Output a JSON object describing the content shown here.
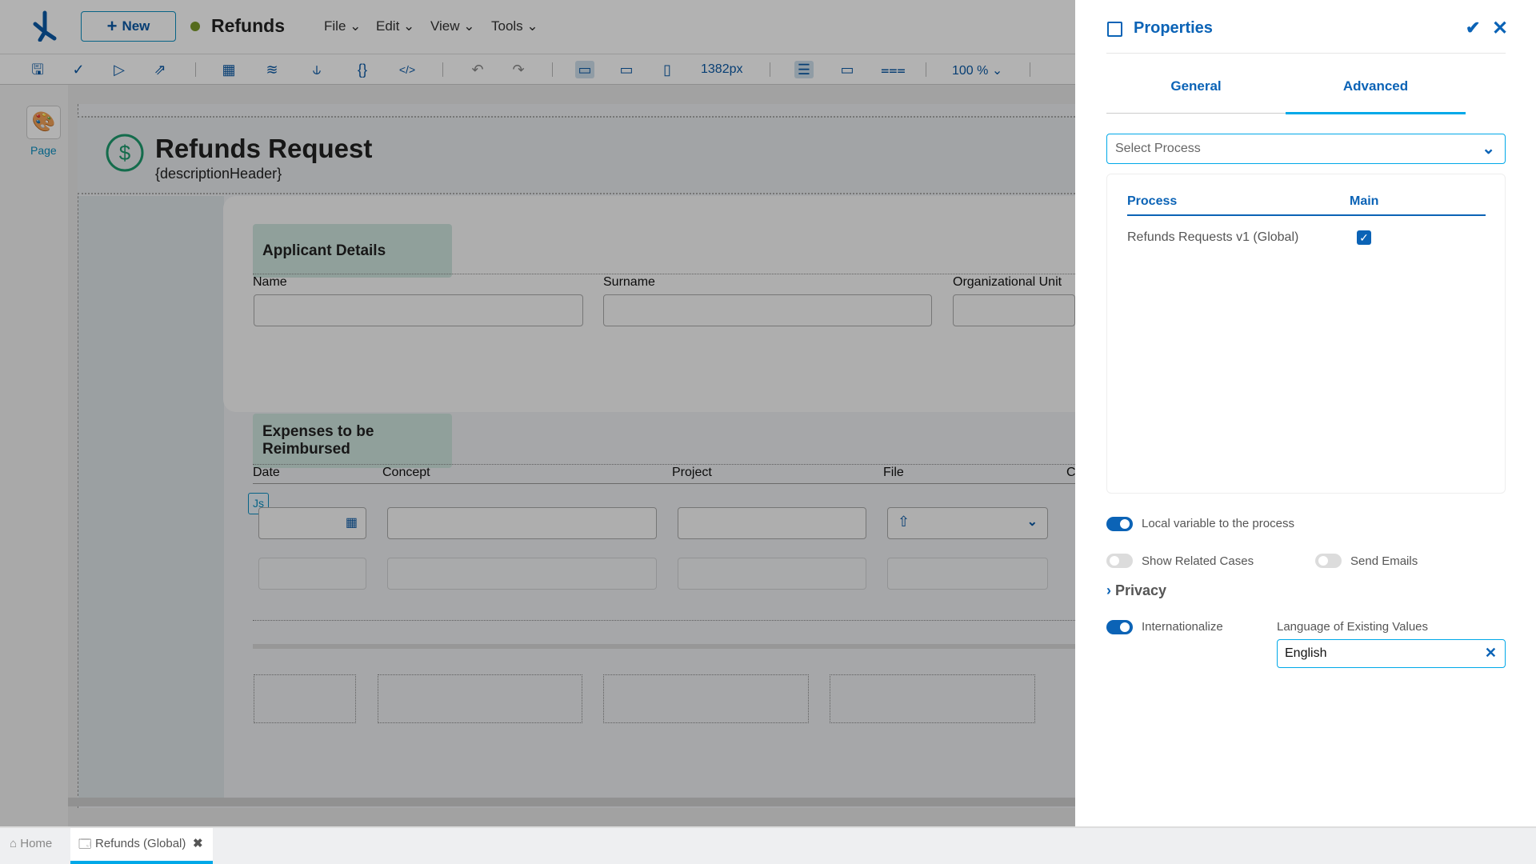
{
  "header": {
    "new_label": "New",
    "app_name": "Refunds",
    "status_color": "#7a9a2a",
    "menus": [
      "File",
      "Edit",
      "View",
      "Tools"
    ]
  },
  "toolbar": {
    "width_readout": "1382px",
    "zoom": "100 %"
  },
  "left_strip": {
    "page_label": "Page"
  },
  "form": {
    "title": "Refunds Request",
    "subtitle": "{descriptionHeader}",
    "applicant": {
      "title": "Applicant Details",
      "fields": [
        "Name",
        "Surname",
        "Organizational Unit"
      ]
    },
    "expenses": {
      "title": "Expenses to be Reimbursed",
      "columns": [
        "Date",
        "Concept",
        "Project",
        "File",
        "C"
      ],
      "js_badge": "Js"
    }
  },
  "panel": {
    "title": "Properties",
    "tabs": [
      "General",
      "Advanced"
    ],
    "active_tab": "Advanced",
    "select_placeholder": "Select Process",
    "table": {
      "headers": [
        "Process",
        "Main"
      ],
      "rows": [
        {
          "process": "Refunds Requests v1 (Global)",
          "main": true
        }
      ]
    },
    "toggles": {
      "local_variable": {
        "label": "Local variable to the process",
        "on": true
      },
      "show_related": {
        "label": "Show Related Cases",
        "on": false
      },
      "send_emails": {
        "label": "Send Emails",
        "on": false
      },
      "internationalize": {
        "label": "Internationalize",
        "on": true
      }
    },
    "privacy_label": "Privacy",
    "language_label": "Language of Existing Values",
    "language_value": "English"
  },
  "bottom_tabs": {
    "home": "Home",
    "active": "Refunds (Global)"
  },
  "colors": {
    "accent": "#0b63b6",
    "tab_underline": "#00a8e8",
    "section_bg": "#cfe6df",
    "dollar_icon": "#1e9b6e"
  }
}
